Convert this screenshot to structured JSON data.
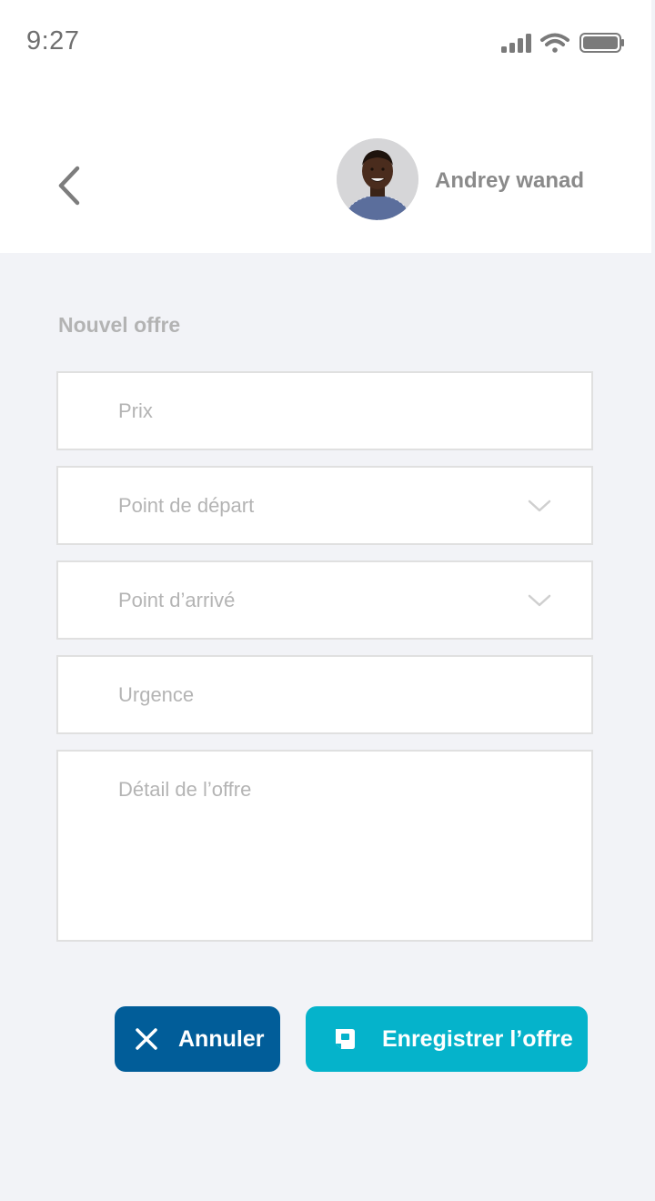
{
  "status_bar": {
    "time": "9:27",
    "signal_icon": "cellular-signal-icon",
    "wifi_icon": "wifi-icon",
    "battery_icon": "battery-icon"
  },
  "header": {
    "back_icon": "chevron-left-icon",
    "user": {
      "name": "Andrey wanad",
      "avatar_icon": "user-avatar"
    }
  },
  "form": {
    "title": "Nouvel offre",
    "fields": [
      {
        "placeholder": "Prix",
        "type": "text"
      },
      {
        "placeholder": "Point de départ",
        "type": "select",
        "icon": "chevron-down-icon"
      },
      {
        "placeholder": "Point d’arrivé",
        "type": "select",
        "icon": "chevron-down-icon"
      },
      {
        "placeholder": "Urgence",
        "type": "text"
      },
      {
        "placeholder": "Détail de l’offre",
        "type": "textarea"
      }
    ]
  },
  "actions": {
    "cancel_label": "Annuler",
    "cancel_icon": "close-icon",
    "save_label": "Enregistrer l’offre",
    "save_icon": "save-icon"
  },
  "colors": {
    "background": "#f2f3f7",
    "cancel_button": "#015d99",
    "save_button": "#05b3cb",
    "muted_text": "#b4b4b4"
  }
}
